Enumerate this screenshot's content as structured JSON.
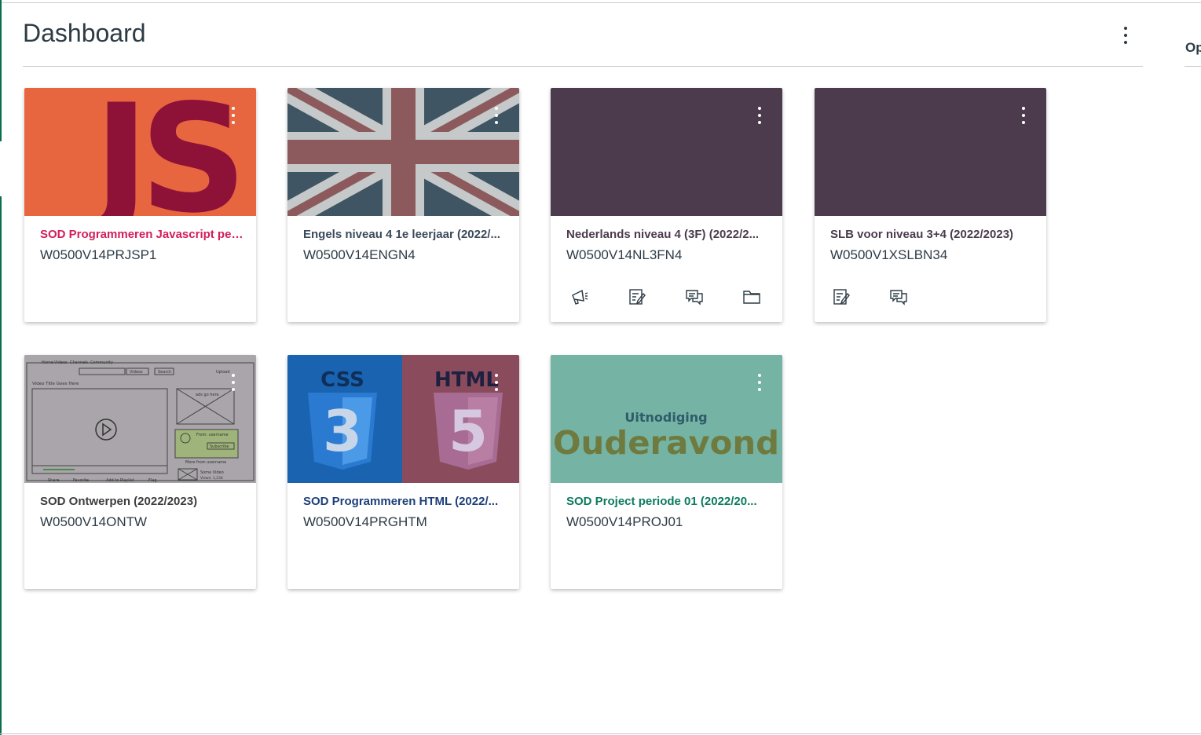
{
  "page": {
    "title": "Dashboard",
    "right_panel_label": "Op"
  },
  "courses": [
    {
      "name": "SOD Programmeren Javascript per...",
      "code": "W0500V14PRJSP1",
      "color": "#d41c5c",
      "hero_label": "JS",
      "actions": []
    },
    {
      "name": "Engels niveau 4 1e leerjaar (2022/...",
      "code": "W0500V14ENGN4",
      "color": "#3b4a5a",
      "actions": []
    },
    {
      "name": "Nederlands niveau 4 (3F) (2022/2...",
      "code": "W0500V14NL3FN4",
      "color": "#4b3b4d",
      "actions": [
        "announcements-icon",
        "assignments-icon",
        "discussions-icon",
        "files-icon"
      ]
    },
    {
      "name": "SLB voor niveau 3+4 (2022/2023)",
      "code": "W0500V1XSLBN34",
      "color": "#4b3b4d",
      "actions": [
        "assignments-icon",
        "discussions-icon"
      ]
    },
    {
      "name": "SOD Ontwerpen (2022/2023)",
      "code": "W0500V14ONTW",
      "color": "#3d3d3d",
      "actions": [],
      "wireframe": {
        "tabs": [
          "Home",
          "Videos",
          "Channels",
          "Community"
        ],
        "videos_label": "Videos",
        "search_label": "Search",
        "upload_label": "Upload",
        "video_title": "Video Title Goes Here",
        "ads": "ads go here",
        "from_label": "From: username",
        "subscribe": "Subscribe",
        "more_from": "More from username",
        "some_video": "Some Video",
        "views": "Views: 1,234",
        "bottom": [
          "Share",
          "Favorite",
          "Add to Playlist",
          "Flag"
        ]
      }
    },
    {
      "name": "SOD Programmeren HTML (2022/...",
      "code": "W0500V14PRGHTM",
      "color": "#1c3f7a",
      "hero_left": "CSS",
      "hero_right": "HTML",
      "num_left": "3",
      "num_right": "5",
      "actions": []
    },
    {
      "name": "SOD Project periode 01 (2022/20...",
      "code": "W0500V14PROJ01",
      "color": "#0d7a5f",
      "hero_small": "Uitnodiging",
      "hero_big": "Ouderavond",
      "actions": []
    }
  ]
}
